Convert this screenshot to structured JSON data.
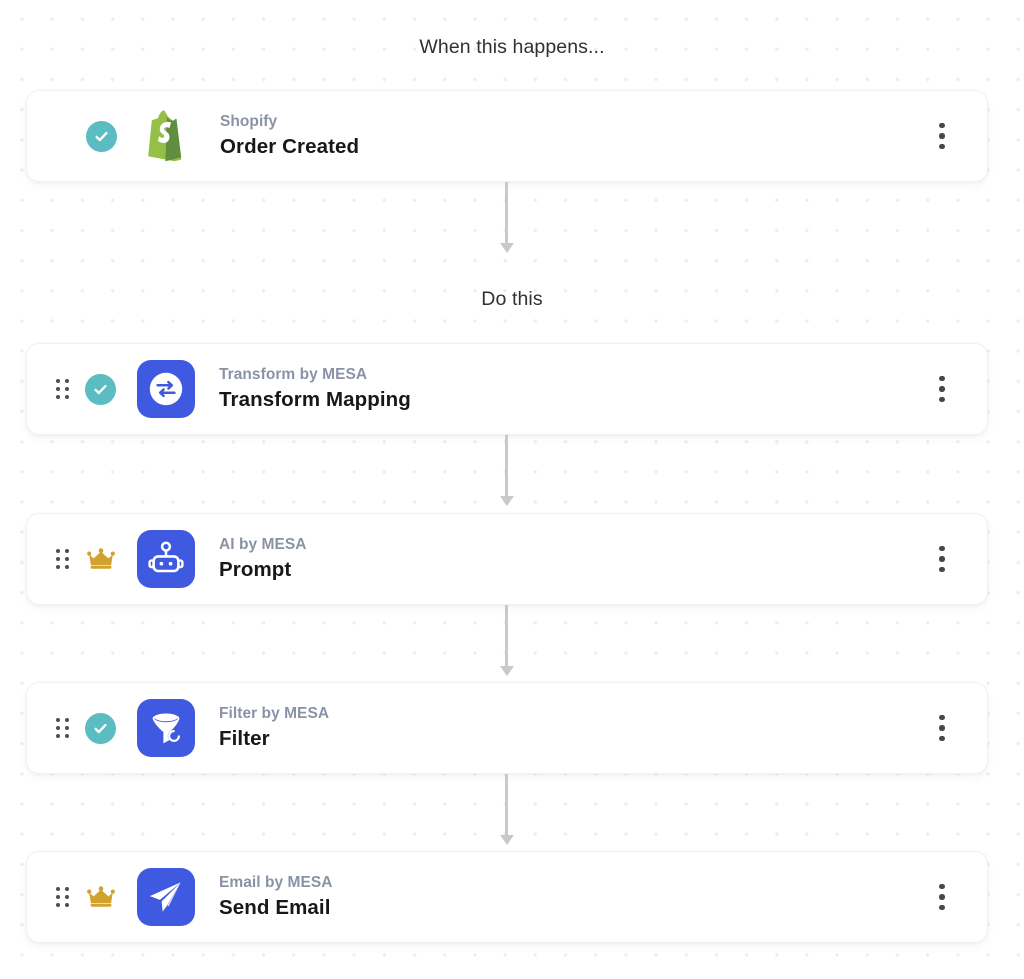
{
  "headings": {
    "trigger": "When this happens...",
    "action": "Do this"
  },
  "colors": {
    "accent_blue": "#3F5AE0",
    "check_teal": "#5BBCC2",
    "crown_gold": "#D2A22E",
    "shopify_green": "#95BF47",
    "connector_gray": "#C7CACD",
    "app_name_gray": "#8A93A6",
    "step_name_dark": "#16191C"
  },
  "steps": [
    {
      "id": "trigger-shopify",
      "app": "Shopify",
      "name": "Order Created",
      "badge": "check",
      "badge_icon": "check-circle-icon",
      "icon": "shopify-bag-icon",
      "icon_style": "plain",
      "has_drag_handle": false,
      "menu_icon": "kebab-menu-icon"
    },
    {
      "id": "action-transform",
      "app": "Transform by MESA",
      "name": "Transform Mapping",
      "badge": "check",
      "badge_icon": "check-circle-icon",
      "icon": "transform-arrows-icon",
      "icon_style": "tile",
      "has_drag_handle": true,
      "menu_icon": "kebab-menu-icon"
    },
    {
      "id": "action-ai",
      "app": "AI by MESA",
      "name": "Prompt",
      "badge": "crown",
      "badge_icon": "crown-icon",
      "icon": "robot-head-icon",
      "icon_style": "tile",
      "has_drag_handle": true,
      "menu_icon": "kebab-menu-icon"
    },
    {
      "id": "action-filter",
      "app": "Filter by MESA",
      "name": "Filter",
      "badge": "check",
      "badge_icon": "check-circle-icon",
      "icon": "funnel-icon",
      "icon_style": "tile",
      "has_drag_handle": true,
      "menu_icon": "kebab-menu-icon"
    },
    {
      "id": "action-email",
      "app": "Email by MESA",
      "name": "Send Email",
      "badge": "crown",
      "badge_icon": "crown-icon",
      "icon": "paper-plane-icon",
      "icon_style": "tile",
      "has_drag_handle": true,
      "menu_icon": "kebab-menu-icon"
    }
  ]
}
